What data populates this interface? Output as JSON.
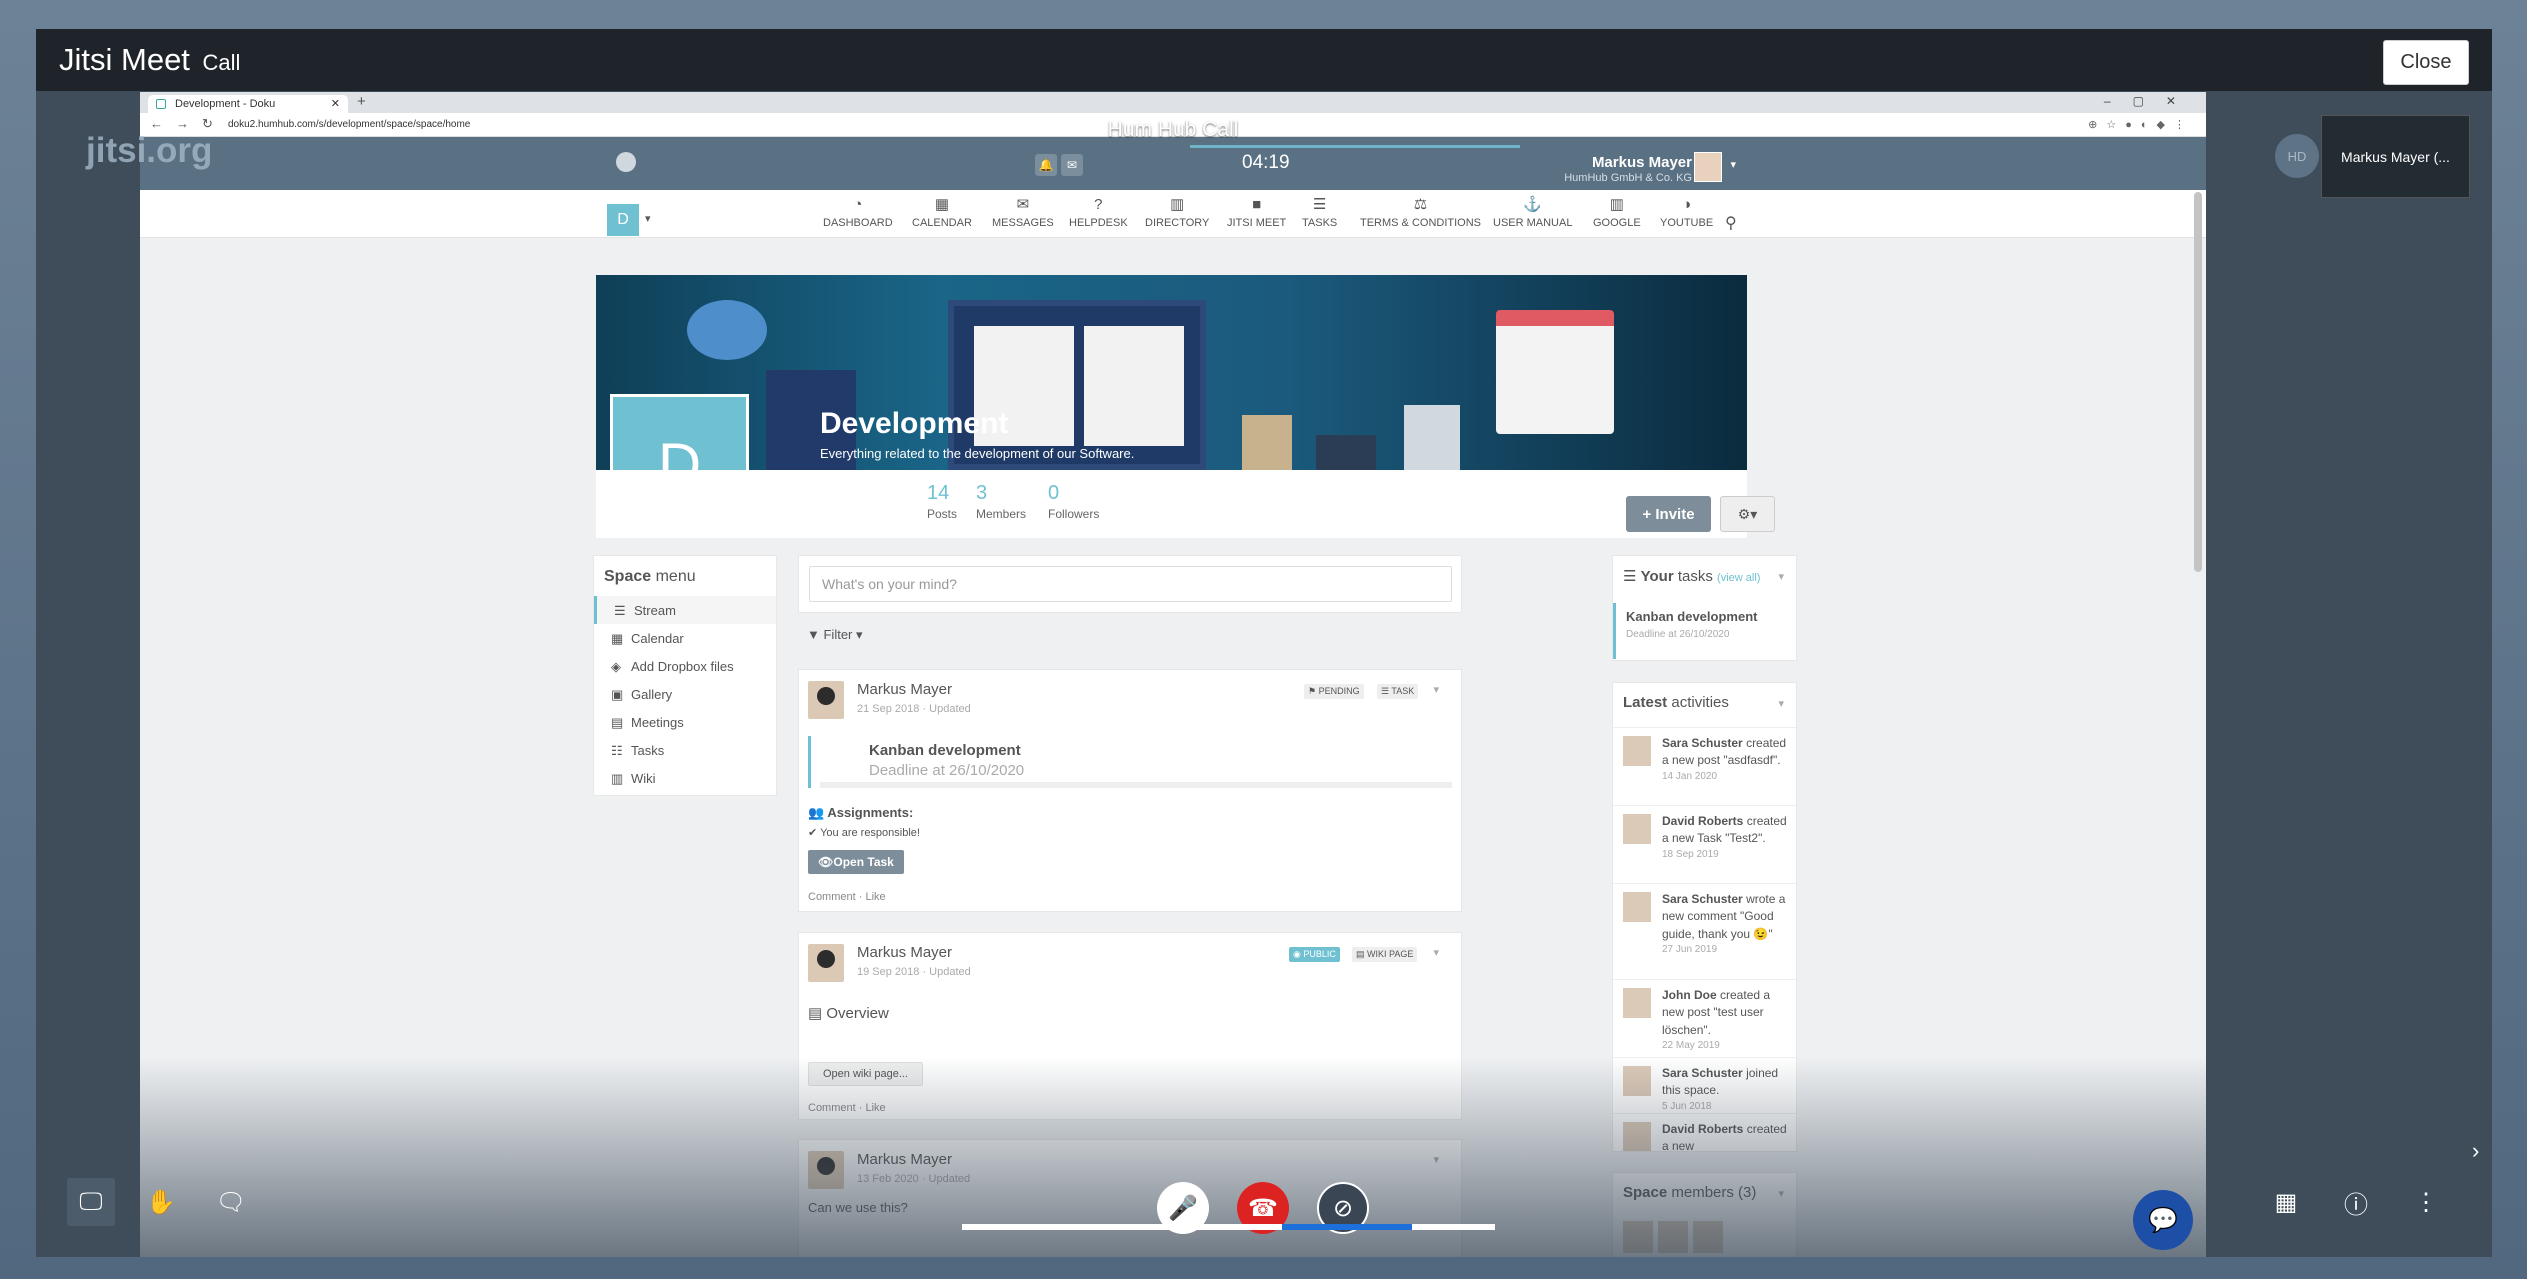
{
  "modal": {
    "title": "Jitsi Meet",
    "subtitle": "Call",
    "close_label": "Close"
  },
  "browser": {
    "tab_title": "Development - Doku",
    "url": "doku2.humhub.com/s/development/space/space/home",
    "call_title": "Hum Hub Call"
  },
  "jitsi": {
    "logo": "jitsi.org",
    "timer": "04:19",
    "thumbnail_name": "Markus Mayer (...",
    "hd_badge": "HD"
  },
  "topbar": {
    "user_name": "Markus Mayer",
    "user_company": "HumHub GmbH & Co. KG"
  },
  "space_chooser": "D",
  "menu": [
    {
      "label": "DASHBOARD",
      "icon": "dashboard-icon"
    },
    {
      "label": "CALENDAR",
      "icon": "calendar-icon"
    },
    {
      "label": "MESSAGES",
      "icon": "envelope-icon"
    },
    {
      "label": "HELPDESK",
      "icon": "question-icon"
    },
    {
      "label": "DIRECTORY",
      "icon": "book-icon"
    },
    {
      "label": "JITSI MEET",
      "icon": "video-icon"
    },
    {
      "label": "TASKS",
      "icon": "tasks-icon"
    },
    {
      "label": "TERMS & CONDITIONS",
      "icon": "legal-icon"
    },
    {
      "label": "USER MANUAL",
      "icon": "anchor-icon"
    },
    {
      "label": "GOOGLE",
      "icon": "book-icon"
    },
    {
      "label": "YOUTUBE",
      "icon": "contrast-icon"
    }
  ],
  "space": {
    "letter": "D",
    "title": "Development",
    "description": "Everything related to the development of our Software.",
    "stats": [
      {
        "value": "14",
        "label": "Posts"
      },
      {
        "value": "3",
        "label": "Members"
      },
      {
        "value": "0",
        "label": "Followers"
      }
    ],
    "invite_label": "Invite"
  },
  "space_menu": {
    "heading_bold": "Space",
    "heading_rest": "menu",
    "items": [
      "Stream",
      "Calendar",
      "Add Dropbox files",
      "Gallery",
      "Meetings",
      "Tasks",
      "Wiki"
    ]
  },
  "composer": {
    "placeholder": "What's on your mind?"
  },
  "filter_label": "Filter",
  "posts": [
    {
      "author": "Markus Mayer",
      "date": "21 Sep 2018 · Updated",
      "labels": [
        "PENDING",
        "TASK"
      ],
      "task_title": "Kanban development",
      "task_deadline": "Deadline at 26/10/2020",
      "assignments": "Assignments:",
      "responsible": "You are responsible!",
      "open_task": "Open Task",
      "actions": "Comment · Like"
    },
    {
      "author": "Markus Mayer",
      "date": "19 Sep 2018 · Updated",
      "labels": [
        "PUBLIC",
        "WIKI PAGE"
      ],
      "content": "Overview",
      "wiki_button": "Open wiki page...",
      "actions": "Comment · Like"
    },
    {
      "author": "Markus Mayer",
      "date": "13 Feb 2020 · Updated",
      "content": "Can we use this?"
    }
  ],
  "your_tasks": {
    "heading_bold": "Your",
    "heading_rest": "tasks",
    "view_all": "(view all)",
    "task_title": "Kanban development",
    "task_deadline": "Deadline at 26/10/2020"
  },
  "latest_activities": {
    "heading_bold": "Latest",
    "heading_rest": "activities",
    "items": [
      {
        "user": "Sara Schuster",
        "text": "created a new post \"asdfasdf\".",
        "date": "14 Jan 2020"
      },
      {
        "user": "David Roberts",
        "text": "created a new Task \"Test2\".",
        "date": "18 Sep 2019"
      },
      {
        "user": "Sara Schuster",
        "text": "wrote a new comment \"Good guide, thank you 😉\"",
        "date": "27 Jun 2019"
      },
      {
        "user": "John Doe",
        "text": "created a new post \"test user löschen\".",
        "date": "22 May 2019"
      },
      {
        "user": "Sara Schuster",
        "text": "joined this space.",
        "date": "5 Jun 2018"
      },
      {
        "user": "David Roberts",
        "text": "created a new",
        "date": ""
      }
    ]
  },
  "space_members": {
    "heading_bold": "Space",
    "heading_rest": "members (3)"
  }
}
